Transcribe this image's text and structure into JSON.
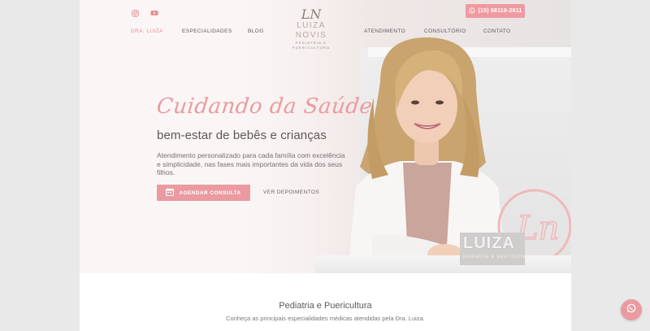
{
  "header": {
    "social_icons": [
      "instagram-icon",
      "youtube-icon"
    ],
    "phone": "(15) 98119-2611",
    "logo": {
      "monogram": "LN",
      "name": "LUIZA NOVIS",
      "tagline": "PEDIATRIA E PUERICULTURA"
    },
    "nav": [
      "DRA. LUIZA",
      "ESPECIALIDADES",
      "BLOG",
      "ATENDIMENTO",
      "CONSULTÓRIO",
      "CONTATO"
    ],
    "nav_active": "DRA. LUIZA"
  },
  "hero": {
    "script_title": "Cuidando da Saúde",
    "subtitle": "bem-estar de bebês e crianças",
    "description": "Atendimento personalizado para cada família com excelência e simplicidade, nas fases mais importantes da vida dos seus filhos.",
    "cta_label": "AGENDAR CONSULTA",
    "secondary_label": "VER DEPOIMENTOS",
    "sign_text": "LUIZA",
    "sign_sub": "pediatria e puericultura"
  },
  "section": {
    "title": "Pediatria e Puericultura",
    "subtitle": "Conheça as principais especialidades médicas atendidas pela Dra. Luiza."
  },
  "colors": {
    "accent": "#ea9aa0",
    "text": "#5e5959"
  }
}
